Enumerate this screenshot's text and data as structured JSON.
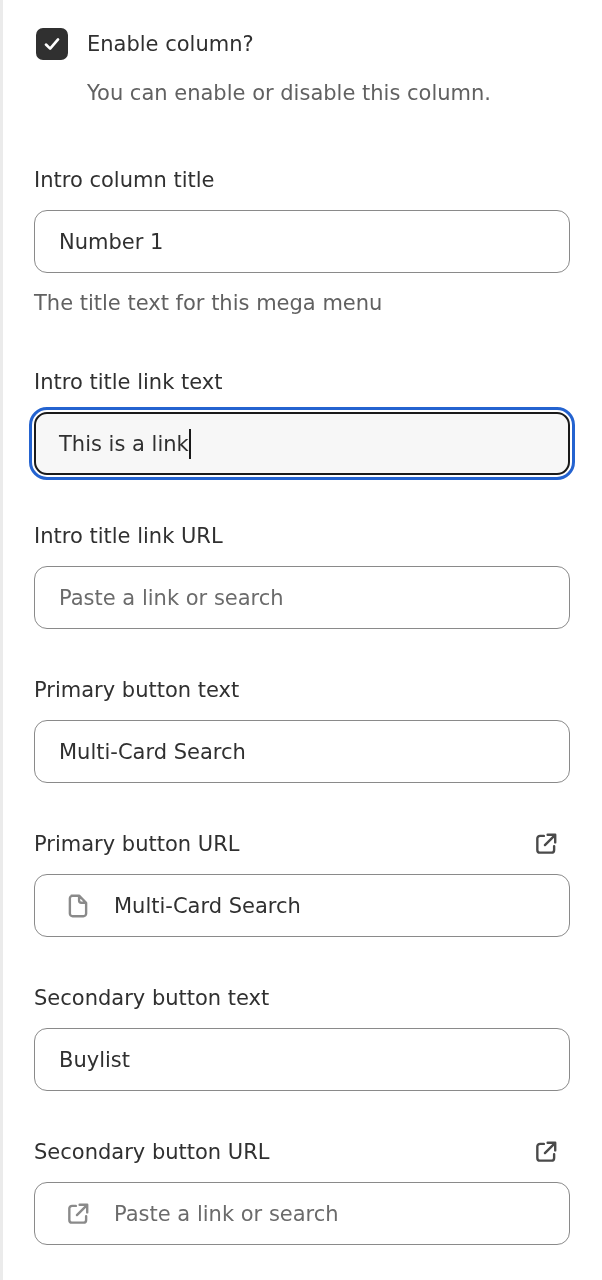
{
  "enable_column": {
    "label": "Enable column?",
    "checked": true,
    "help": "You can enable or disable this column."
  },
  "fields": [
    {
      "kind": "text",
      "label": "Intro column title",
      "value": "Number 1",
      "help": "The title text for this mega menu",
      "focused": false
    },
    {
      "kind": "text",
      "label": "Intro title link text",
      "value": "This is a link",
      "focused": true
    },
    {
      "kind": "text",
      "label": "Intro title link URL",
      "placeholder": "Paste a link or search",
      "focused": false
    },
    {
      "kind": "text",
      "label": "Primary button text",
      "value": "Multi-Card Search",
      "focused": false
    },
    {
      "kind": "link_picker",
      "label": "Primary button URL",
      "value": "Multi-Card Search",
      "focused": false
    },
    {
      "kind": "text",
      "label": "Secondary button text",
      "value": "Buylist",
      "focused": false
    },
    {
      "kind": "link_picker",
      "label": "Secondary button URL",
      "placeholder": "Paste a link or search",
      "focused": false
    }
  ]
}
